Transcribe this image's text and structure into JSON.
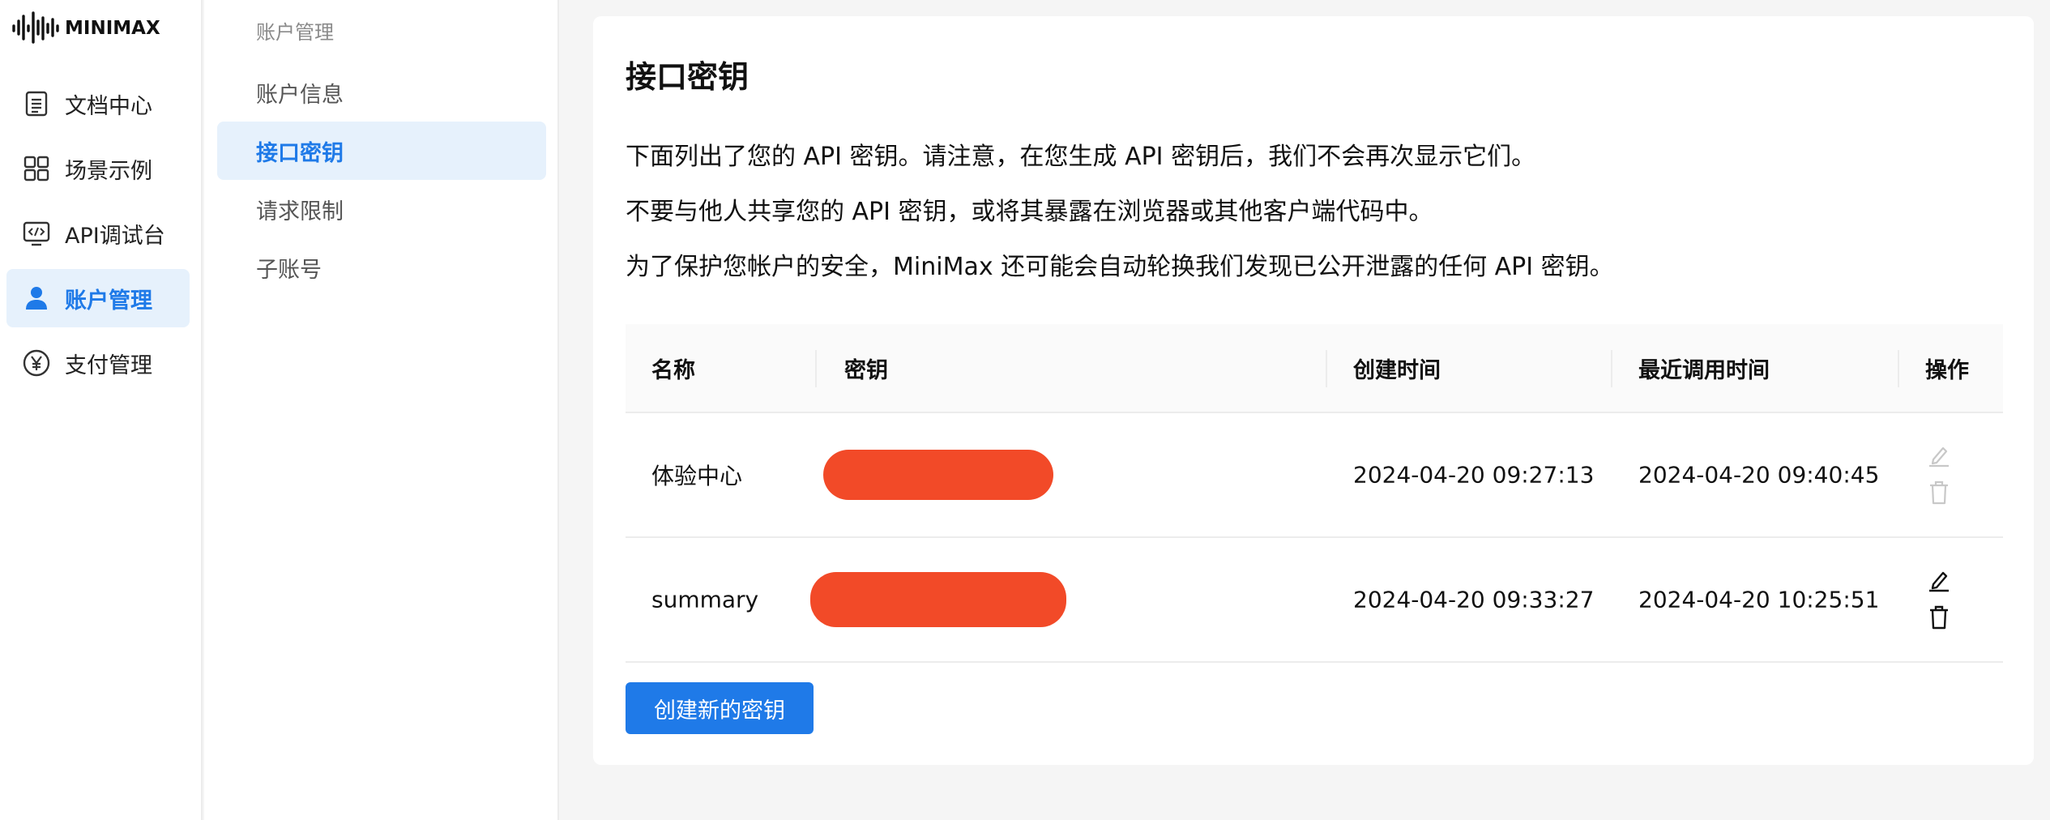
{
  "brand": {
    "logo_text": "MINIMAX"
  },
  "sidebar": {
    "items": [
      {
        "label": "文档中心",
        "icon": "document-icon",
        "active": false
      },
      {
        "label": "场景示例",
        "icon": "grid-icon",
        "active": false
      },
      {
        "label": "API调试台",
        "icon": "code-icon",
        "active": false
      },
      {
        "label": "账户管理",
        "icon": "user-icon",
        "active": true
      },
      {
        "label": "支付管理",
        "icon": "yen-icon",
        "active": false
      }
    ]
  },
  "subnav": {
    "title": "账户管理",
    "items": [
      {
        "label": "账户信息",
        "active": false
      },
      {
        "label": "接口密钥",
        "active": true
      },
      {
        "label": "请求限制",
        "active": false
      },
      {
        "label": "子账号",
        "active": false
      }
    ]
  },
  "main": {
    "title": "接口密钥",
    "description": [
      "下面列出了您的 API 密钥。请注意，在您生成 API 密钥后，我们不会再次显示它们。",
      "不要与他人共享您的 API 密钥，或将其暴露在浏览器或其他客户端代码中。",
      "为了保护您帐户的安全，MiniMax 还可能会自动轮换我们发现已公开泄露的任何 API 密钥。"
    ],
    "table": {
      "headers": [
        "名称",
        "密钥",
        "创建时间",
        "最近调用时间",
        "操作"
      ],
      "rows": [
        {
          "name": "体验中心",
          "created": "2024-04-20 09:27:13",
          "last_used": "2024-04-20 09:40:45",
          "actions_enabled": false
        },
        {
          "name": "summary",
          "created": "2024-04-20 09:33:27",
          "last_used": "2024-04-20 10:25:51",
          "actions_enabled": true
        }
      ]
    },
    "create_button": "创建新的密钥"
  },
  "colors": {
    "accent": "#1f7ae8",
    "accent_bg": "#e6f1fc",
    "redaction": "#f24a28",
    "disabled_icon": "#c8c8c8"
  }
}
